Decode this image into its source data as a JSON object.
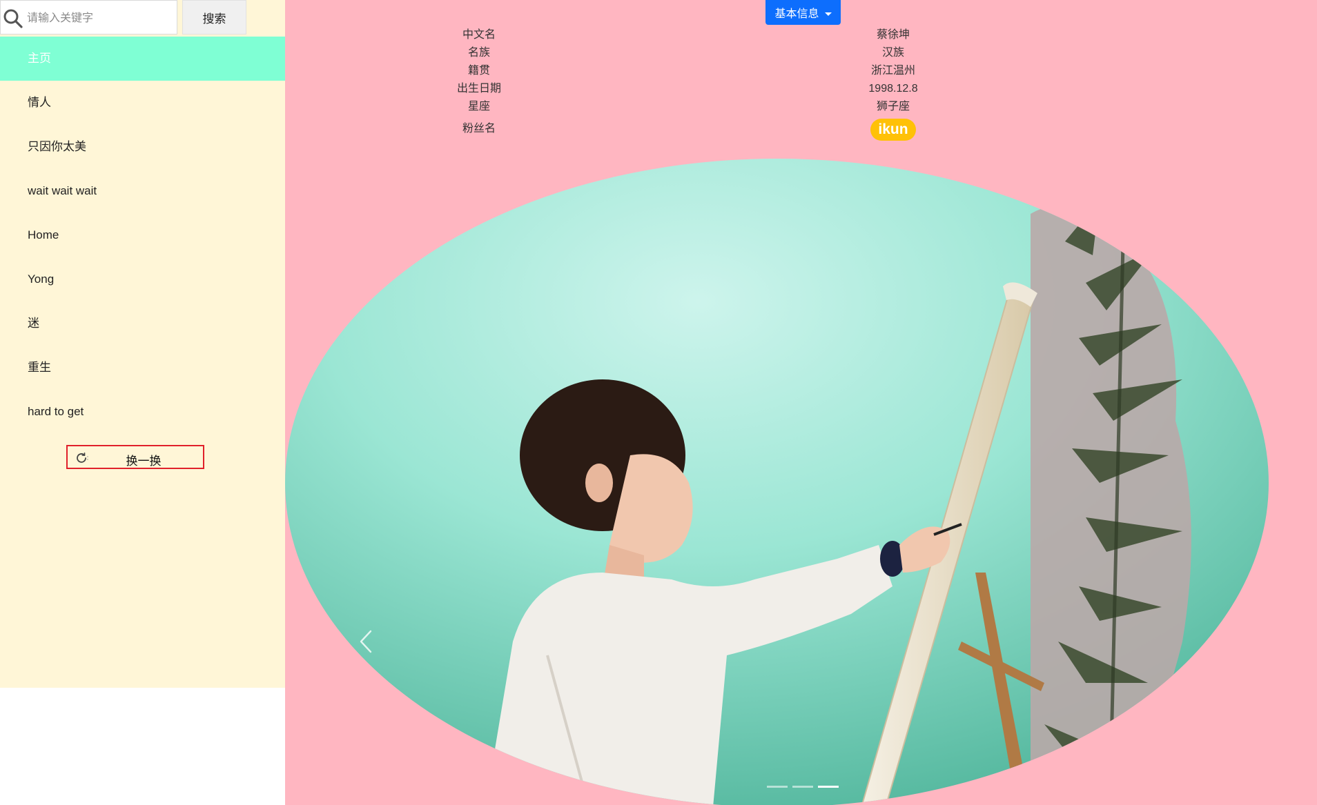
{
  "search": {
    "placeholder": "请输入关键字",
    "button_label": "搜索"
  },
  "sidebar": {
    "items": [
      {
        "label": "主页",
        "active": true
      },
      {
        "label": "情人",
        "active": false
      },
      {
        "label": "只因你太美",
        "active": false
      },
      {
        "label": "wait wait wait",
        "active": false
      },
      {
        "label": "Home",
        "active": false
      },
      {
        "label": "Yong",
        "active": false
      },
      {
        "label": "迷",
        "active": false
      },
      {
        "label": "重生",
        "active": false
      },
      {
        "label": "hard to get",
        "active": false
      }
    ],
    "refresh_label": "换一换",
    "refresh_icon": "refresh-icon"
  },
  "main": {
    "dropdown_label": "基本信息",
    "info": [
      {
        "label": "中文名",
        "value": "蔡徐坤"
      },
      {
        "label": "名族",
        "value": "汉族"
      },
      {
        "label": "籍贯",
        "value": "浙江温州"
      },
      {
        "label": "出生日期",
        "value": "1998.12.8"
      },
      {
        "label": "星座",
        "value": "狮子座"
      }
    ],
    "fan_name_label": "粉丝名",
    "fan_name_badge": "ikun",
    "carousel": {
      "image_description": "photo-painting-at-easel",
      "slide_count": 3,
      "active_index": 2
    }
  },
  "colors": {
    "sidebar_bg": "#fff6d7",
    "active_item_bg": "#7fffd4",
    "main_bg": "#ffb6c1",
    "dropdown_bg": "#0d6efd",
    "badge_bg": "#ffc107",
    "refresh_border": "#e0202a"
  }
}
